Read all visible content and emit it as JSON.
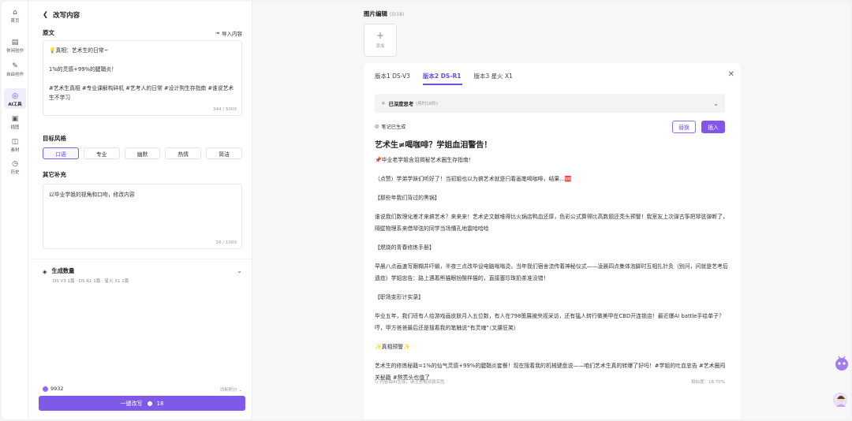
{
  "rail": {
    "items": [
      {
        "label": "首页",
        "icon": "home-icon"
      },
      {
        "label": "休闲创作",
        "icon": "document-icon"
      },
      {
        "label": "自由创作",
        "icon": "pen-icon"
      },
      {
        "label": "AI工具",
        "icon": "ai-icon"
      },
      {
        "label": "插图",
        "icon": "image-icon"
      },
      {
        "label": "素材",
        "icon": "material-icon"
      },
      {
        "label": "历史",
        "icon": "history-icon"
      }
    ]
  },
  "panel": {
    "title": "改写内容",
    "original_label": "原文",
    "import_label": "导入内容",
    "original_text": "💡真相：艺术生的日常~\n\n1%的灵感+99%的腱鞘炎！\n\n#艺术生真相 #专业课解构碎机 #艺考人的日常 #设计狗生存指南 #谁说艺术生不学习",
    "original_count": "344 / 5000",
    "style_label": "目标风格",
    "styles": [
      "口语",
      "专业",
      "幽默",
      "热情",
      "简洁"
    ],
    "selected_style": "口语",
    "extra_label": "其它补充",
    "extra_text": "以毕业学姐的视角和口吻，修改内容",
    "extra_count": "16 / 1000",
    "gen_count_title": "生成数量",
    "gen_count_sub": "DS V3 1篇 · DS R1 1篇 · 星火 X1 1篇",
    "credits": "9932",
    "rules": "消耗积分",
    "submit_label": "一键改写",
    "submit_cost": "18"
  },
  "image_edit": {
    "title": "图片编辑",
    "count": "(0/18)",
    "add_label": "添加"
  },
  "result": {
    "tabs": [
      "版本1 DS-V3",
      "版本2 DS-R1",
      "版本3 星火 X1"
    ],
    "active_tab": 1,
    "think_label": "已深度思考",
    "think_sub": "(用时18秒)",
    "generated_note": "笔记已生成",
    "replace_label": "替换",
    "insert_label": "插入",
    "article_title": "艺术生≠喝咖啡？学姐血泪警告！",
    "paragraphs": [
      "📌毕业老学姐含泪揭秘艺术圈生存指南！",
      "（点赞）学弟学妹们听好了！当初姐也以为搞艺术就是闩着画笔喝咖啡，结果...🆘",
      "【那些年我们背过的黑锅】",
      "谁说我们数理化差才来搞艺术？来来来！艺术史文献堆得比火锅店鸭血还厚，色彩公式算得比高数题还秃头预警！我室友上次弹古筝把琴弦弹断了，隔壁物理系来借琴弦的同学当场懵孔地震哈哈哈",
      "【燃烧的青春修炼手册】",
      "早晨八点画速写跟糊井吓躺，半夜三点改毕设电脑嗡嗡烫，当年我们宿舍流传着神秘仪式——凌晨四点集体泡脚时互相扎针灸（别问，问就是艺考后遗症）学姐忠告：路上遇着熊猫眼扮酸样猫的，直接塞珍珠奶茶准没错！",
      "【职场变形计实录】",
      "毕业五年，我们班有人给游戏画皮肤月入五位数，有人在798策展被央视采访，还有猛人转行做美甲在CBD开连锁店！最近爆AI battle手绘单子？哼，甲方爸爸最后还是搜着我的笔触说“有灵魂”（叉腰狂笑）",
      "✨真相预警✨",
      "艺术生的修炼秘籍=1%的仙气灵感+99%的腱鞘炎套餐！现在搜着我的机械键盘说——咱们艺术生真的转爆了好吗！#学姐的吐血忠告 #艺术圈闯关秘籍 #熬秃头也值了"
    ],
    "footer_left": "⊙ 内容由AI生成，请注意甄别真实性",
    "footer_right": "相似度：18.70%"
  },
  "colors": {
    "accent": "#7f5ae6"
  }
}
